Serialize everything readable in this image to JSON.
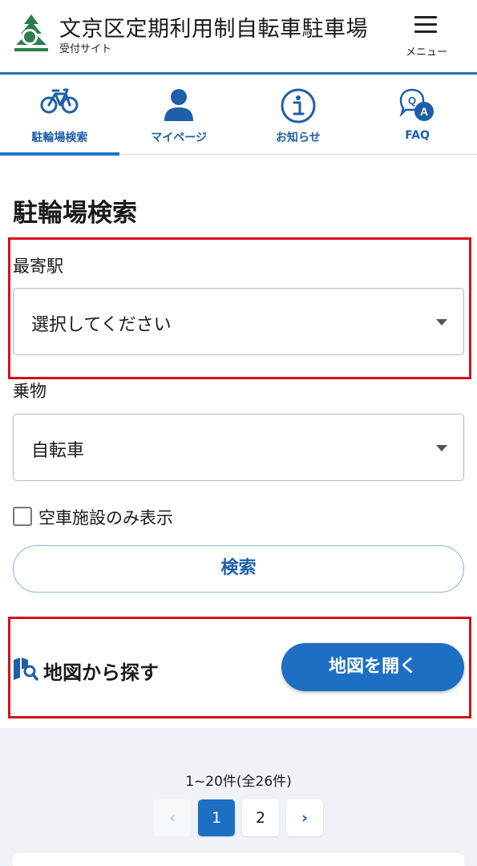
{
  "header": {
    "title": "文京区定期利用制自転車駐車場",
    "subtitle": "受付サイト",
    "menu_label": "メニュー",
    "logo_icon": "bunkyo-ward-logo-icon"
  },
  "tabs": [
    {
      "label": "駐輪場検索",
      "icon": "bicycle-icon",
      "active": true
    },
    {
      "label": "マイページ",
      "icon": "person-icon",
      "active": false
    },
    {
      "label": "お知らせ",
      "icon": "info-icon",
      "active": false
    },
    {
      "label": "FAQ",
      "icon": "qa-bubble-icon",
      "active": false
    }
  ],
  "search": {
    "title": "駐輪場検索",
    "station_label": "最寄駅",
    "station_value": "選択してください",
    "vehicle_label": "乗物",
    "vehicle_value": "自転車",
    "vacancy_label": "空車施設のみ表示",
    "vacancy_checked": false,
    "search_button": "検索"
  },
  "map": {
    "label": "地図から探す",
    "button": "地図を開く"
  },
  "results": {
    "count_text": "1~20件(全26件)",
    "pagination": {
      "prev": "‹",
      "pages": [
        "1",
        "2"
      ],
      "current": "1",
      "next": "›"
    }
  },
  "colors": {
    "brand_blue": "#1d6fc3",
    "header_line": "#2e6fb3",
    "highlight_red": "#d0121b",
    "logo_green": "#2e7d4f"
  }
}
